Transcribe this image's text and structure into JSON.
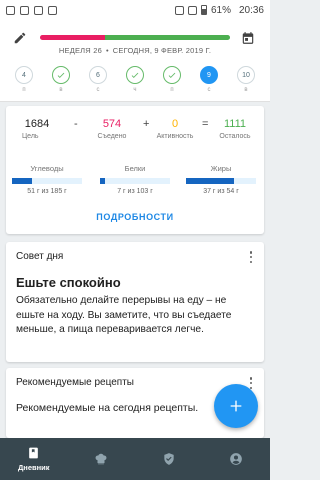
{
  "status_bar": {
    "battery": "61%",
    "time": "20:36"
  },
  "header": {
    "week": "НЕДЕЛЯ 26",
    "date": "СЕГОДНЯ, 9 ФЕВР. 2019 Г.",
    "progress_eaten_fraction": 0.34,
    "progress_remaining_fraction": 0.66,
    "colors": {
      "eaten": "#e91e63",
      "remaining": "#4caf50",
      "accent": "#2196f3"
    }
  },
  "days": [
    {
      "num": "4",
      "name": "п",
      "state": "plain"
    },
    {
      "num": "",
      "name": "в",
      "state": "done"
    },
    {
      "num": "6",
      "name": "с",
      "state": "plain"
    },
    {
      "num": "",
      "name": "ч",
      "state": "done"
    },
    {
      "num": "",
      "name": "п",
      "state": "done"
    },
    {
      "num": "9",
      "name": "с",
      "state": "active"
    },
    {
      "num": "10",
      "name": "в",
      "state": "plain"
    }
  ],
  "summary": {
    "goal_value": "1684",
    "goal_label": "Цель",
    "minus": "-",
    "eaten_value": "574",
    "eaten_label": "Съедено",
    "plus": "+",
    "activity_value": "0",
    "activity_label": "Активность",
    "equals": "=",
    "remaining_value": "1111",
    "remaining_label": "Осталось",
    "colors": {
      "eaten": "#e91e63",
      "activity": "#ffb300",
      "remaining": "#4caf50"
    },
    "macros": [
      {
        "name": "Углеводы",
        "value": "51 г из 185 г",
        "fraction": 0.28
      },
      {
        "name": "Белки",
        "value": "7 г из 103 г",
        "fraction": 0.07
      },
      {
        "name": "Жиры",
        "value": "37 г из 54 г",
        "fraction": 0.69
      }
    ],
    "details_label": "ПОДРОБНОСТИ"
  },
  "tip": {
    "header": "Совет дня",
    "title": "Ешьте спокойно",
    "body": "Обязательно делайте перерывы на еду – не ешьте на ходу. Вы заметите, что вы съедаете меньше, а пища переваривается легче."
  },
  "recipes": {
    "header": "Рекомендуемые рецепты",
    "body": "Рекомендуемые на сегодня рецепты."
  },
  "bottom_nav": {
    "items": [
      {
        "label": "Дневник",
        "icon": "diary-icon"
      },
      {
        "label": "",
        "icon": "chef-hat-icon"
      },
      {
        "label": "",
        "icon": "shield-check-icon"
      },
      {
        "label": "",
        "icon": "profile-icon"
      }
    ]
  }
}
